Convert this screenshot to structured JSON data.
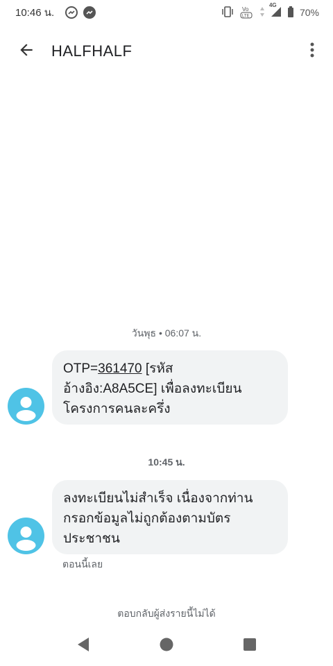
{
  "status_bar": {
    "time": "10:46 น.",
    "battery": "70%",
    "network": "4G",
    "left_icons": [
      "messenger-outline-icon",
      "messenger-filled-icon"
    ],
    "right_icons": [
      "vibrate-icon",
      "volte-icon",
      "data-arrows-icon",
      "signal-icon",
      "battery-icon"
    ]
  },
  "app_bar": {
    "title": "HALFHALF",
    "back_icon": "arrow-back-icon",
    "menu_icon": "more-vert-icon"
  },
  "conversation": [
    {
      "timestamp_day": "วันพุธ",
      "timestamp_sep": " • ",
      "timestamp_time": "06:07 น.",
      "message": {
        "prefix": "OTP=",
        "code": "361470",
        "line1_rest": " [รหัส",
        "line2": "อ้างอิง:A8A5CE] เพื่อลงทะเบียน",
        "line3": "โครงการคนละครึ่ง"
      }
    },
    {
      "timestamp_time": "10:45 น.",
      "message": {
        "line1": "ลงทะเบียนไม่สำเร็จ เนื่องจากท่าน",
        "line2": "กรอกข้อมูลไม่ถูกต้องตามบัตร",
        "line3": "ประชาชน"
      },
      "status": "ตอนนี้เลย"
    }
  ],
  "reply_note": "ตอบกลับผู้ส่งรายนี้ไม่ได้",
  "colors": {
    "avatar": "#4fc3e6",
    "bubble": "#f1f3f4"
  }
}
